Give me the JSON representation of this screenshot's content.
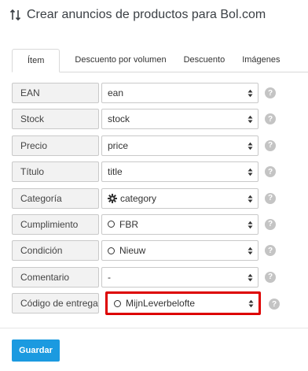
{
  "header": {
    "title": "Crear anuncios de productos para Bol.com",
    "icon": "sort-arrows-icon"
  },
  "tabs": [
    {
      "label": "Ítem",
      "active": true
    },
    {
      "label": "Descuento por volumen",
      "active": false
    },
    {
      "label": "Descuento",
      "active": false
    },
    {
      "label": "Imágenes",
      "active": false
    }
  ],
  "fields": [
    {
      "label": "EAN",
      "value": "ean",
      "icon": ""
    },
    {
      "label": "Stock",
      "value": "stock",
      "icon": ""
    },
    {
      "label": "Precio",
      "value": "price",
      "icon": ""
    },
    {
      "label": "Título",
      "value": "title",
      "icon": ""
    },
    {
      "label": "Categoría",
      "value": "category",
      "icon": "gear-icon"
    },
    {
      "label": "Cumplimiento",
      "value": "FBR",
      "icon": "circle-icon"
    },
    {
      "label": "Condición",
      "value": "Nieuw",
      "icon": "circle-icon"
    },
    {
      "label": "Comentario",
      "value": "-",
      "icon": ""
    },
    {
      "label": "Código de entrega",
      "value": "MijnLeverbelofte",
      "icon": "circle-icon",
      "highlighted": true
    }
  ],
  "help_glyph": "?",
  "save_label": "Guardar",
  "colors": {
    "accent": "#1b9ae0",
    "highlight": "#dd0000",
    "label_bg": "#f2f2f2"
  }
}
